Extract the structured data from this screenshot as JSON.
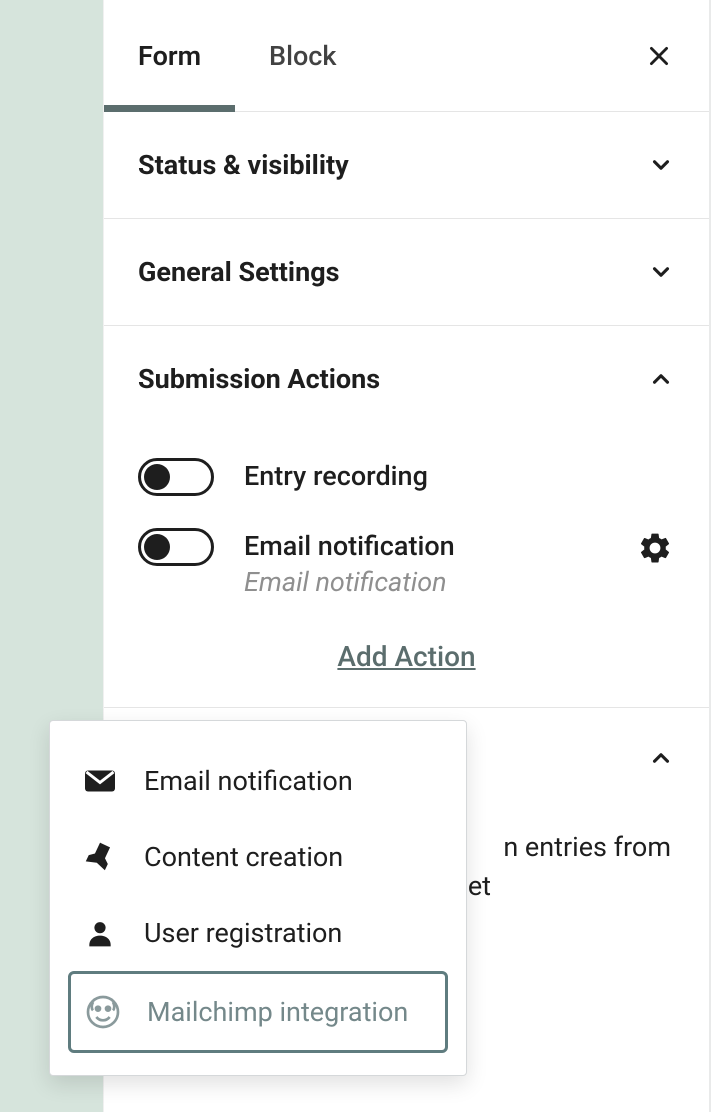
{
  "tabs": {
    "form": "Form",
    "block": "Block"
  },
  "panels": {
    "status": {
      "title": "Status & visibility"
    },
    "general": {
      "title": "General Settings"
    },
    "submission": {
      "title": "Submission Actions",
      "toggles": {
        "entry": {
          "label": "Entry recording"
        },
        "email": {
          "label": "Email notification",
          "sub": "Email notification"
        }
      },
      "add_action": "Add Action"
    },
    "spam": {
      "text_fragment_1": "n entries from",
      "text_fragment_2": "met"
    }
  },
  "popover": {
    "items": [
      {
        "label": "Email notification",
        "icon": "mail"
      },
      {
        "label": "Content creation",
        "icon": "pin"
      },
      {
        "label": "User registration",
        "icon": "user"
      },
      {
        "label": "Mailchimp integration",
        "icon": "mailchimp",
        "selected": true
      }
    ]
  }
}
